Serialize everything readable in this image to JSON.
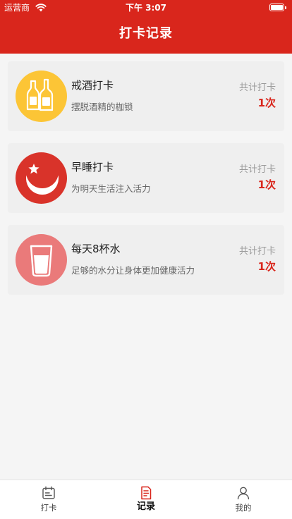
{
  "status_bar": {
    "carrier": "运营商",
    "time": "下午 3:07",
    "wifi_icon": "wifi-icon",
    "battery_icon": "battery-icon",
    "battery_level": 1.0
  },
  "nav": {
    "title": "打卡记录"
  },
  "colors": {
    "brand": "#d9261c",
    "quit_drinking_bg": "#fcc536",
    "early_sleep_bg": "#d9332a",
    "water_bg": "#ea7a7a",
    "card_bg": "#efefef"
  },
  "cards": [
    {
      "icon": "bottles-icon",
      "title": "戒酒打卡",
      "subtitle": "摆脱酒精的枷锁",
      "total_label": "共计打卡",
      "total_count": "1次"
    },
    {
      "icon": "moon-star-icon",
      "title": "早睡打卡",
      "subtitle": "为明天生活注入活力",
      "total_label": "共计打卡",
      "total_count": "1次"
    },
    {
      "icon": "water-glass-icon",
      "title": "每天8杯水",
      "subtitle": "足够的水分让身体更加健康活力",
      "total_label": "共计打卡",
      "total_count": "1次"
    }
  ],
  "tabs": [
    {
      "icon": "calendar-icon",
      "label": "打卡",
      "active": false
    },
    {
      "icon": "document-icon",
      "label": "记录",
      "active": true
    },
    {
      "icon": "person-icon",
      "label": "我的",
      "active": false
    }
  ]
}
